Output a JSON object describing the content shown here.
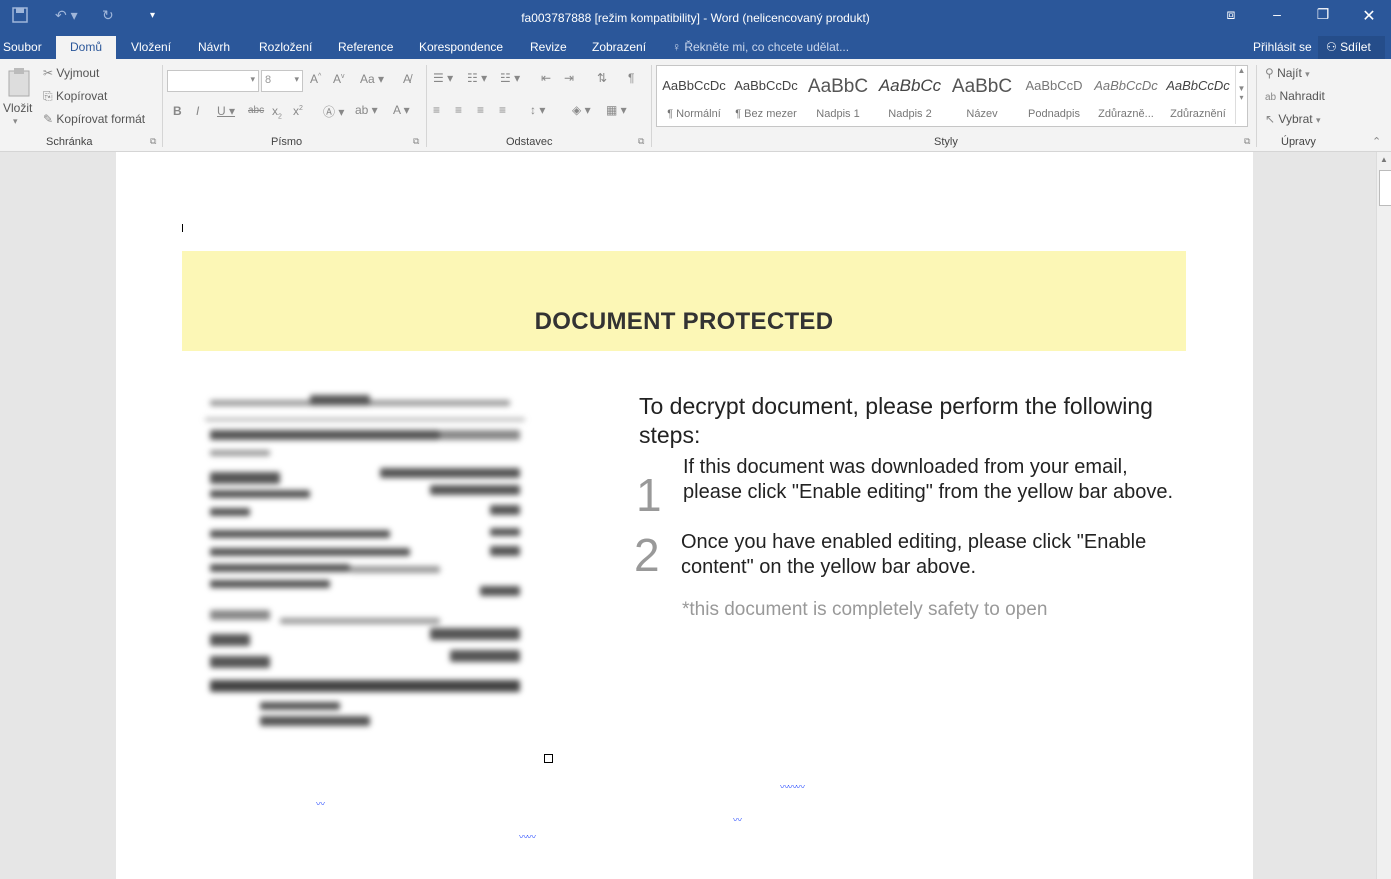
{
  "window": {
    "title": "fa003787888 [režim kompatibility] - Word (nelicencovaný produkt)"
  },
  "tabs": {
    "file": "Soubor",
    "home": "Domů",
    "insert": "Vložení",
    "design": "Návrh",
    "layout": "Rozložení",
    "references": "Reference",
    "mailings": "Korespondence",
    "review": "Revize",
    "view": "Zobrazení",
    "tell_me": "Řekněte mi, co chcete udělat...",
    "sign_in": "Přihlásit se",
    "share": "Sdílet"
  },
  "ribbon": {
    "clipboard": {
      "paste": "Vložit",
      "cut": "Vyjmout",
      "copy": "Kopírovat",
      "format_painter": "Kopírovat formát",
      "label": "Schránka"
    },
    "font": {
      "size": "8",
      "label": "Písmo"
    },
    "paragraph": {
      "label": "Odstavec"
    },
    "styles": {
      "label": "Styly",
      "items": [
        {
          "preview": "AaBbCcDc",
          "name": "¶ Normální"
        },
        {
          "preview": "AaBbCcDc",
          "name": "¶ Bez mezer"
        },
        {
          "preview": "AaBbC",
          "name": "Nadpis 1"
        },
        {
          "preview": "AaBbCc",
          "name": "Nadpis 2"
        },
        {
          "preview": "AaBbC",
          "name": "Název"
        },
        {
          "preview": "AaBbCcD",
          "name": "Podnadpis"
        },
        {
          "preview": "AaBbCcDc",
          "name": "Zdůrazně..."
        },
        {
          "preview": "AaBbCcDc",
          "name": "Zdůraznění"
        }
      ]
    },
    "editing": {
      "find": "Najít",
      "replace": "Nahradit",
      "select": "Vybrat",
      "label": "Úpravy"
    }
  },
  "document": {
    "banner_title": "DOCUMENT PROTECTED",
    "heading": "To decrypt document, please perform the following steps:",
    "step1_number": "1",
    "step1": "If this document was downloaded from your email, please click \"Enable editing\" from the yellow bar above.",
    "step2_number": "2",
    "step2": "Once you have enabled editing, please click \"Enable content\" on the yellow bar above.",
    "note": "*this document is completely safety to open"
  }
}
